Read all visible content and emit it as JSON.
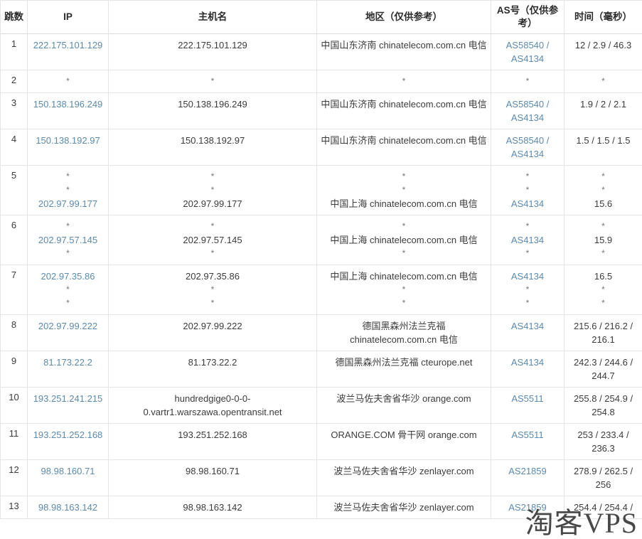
{
  "table": {
    "headers": [
      {
        "label": "跳数",
        "key": "hop"
      },
      {
        "label": "IP",
        "key": "ip"
      },
      {
        "label": "主机名",
        "key": "host"
      },
      {
        "label": "地区（仅供参考）",
        "key": "geo"
      },
      {
        "label": "AS号（仅供参考）",
        "key": "as"
      },
      {
        "label": "时间（毫秒）",
        "key": "time"
      }
    ],
    "star_glyph": "*",
    "link_color": "#5b8ab0",
    "rows": [
      {
        "hop": "1",
        "ip_lines": [
          {
            "text": "222.175.101.129",
            "link": true
          }
        ],
        "host_lines": [
          {
            "text": "222.175.101.129",
            "link": false
          }
        ],
        "geo_lines": [
          {
            "text": "中国山东济南 chinatelecom.com.cn 电信",
            "link": false
          }
        ],
        "as_lines": [
          {
            "text": "AS58540 / AS4134",
            "link": true
          }
        ],
        "time_lines": [
          {
            "text": "12 / 2.9 / 46.3",
            "link": false
          }
        ]
      },
      {
        "hop": "2",
        "ip_lines": [
          {
            "text": "*",
            "link": false
          }
        ],
        "host_lines": [
          {
            "text": "*",
            "link": false
          }
        ],
        "geo_lines": [
          {
            "text": "*",
            "link": false
          }
        ],
        "as_lines": [
          {
            "text": "*",
            "link": false
          }
        ],
        "time_lines": [
          {
            "text": "*",
            "link": false
          }
        ]
      },
      {
        "hop": "3",
        "ip_lines": [
          {
            "text": "150.138.196.249",
            "link": true
          }
        ],
        "host_lines": [
          {
            "text": "150.138.196.249",
            "link": false
          }
        ],
        "geo_lines": [
          {
            "text": "中国山东济南 chinatelecom.com.cn 电信",
            "link": false
          }
        ],
        "as_lines": [
          {
            "text": "AS58540 / AS4134",
            "link": true
          }
        ],
        "time_lines": [
          {
            "text": "1.9 / 2 / 2.1",
            "link": false
          }
        ]
      },
      {
        "hop": "4",
        "ip_lines": [
          {
            "text": "150.138.192.97",
            "link": true
          }
        ],
        "host_lines": [
          {
            "text": "150.138.192.97",
            "link": false
          }
        ],
        "geo_lines": [
          {
            "text": "中国山东济南 chinatelecom.com.cn 电信",
            "link": false
          }
        ],
        "as_lines": [
          {
            "text": "AS58540 / AS4134",
            "link": true
          }
        ],
        "time_lines": [
          {
            "text": "1.5 / 1.5 / 1.5",
            "link": false
          }
        ]
      },
      {
        "hop": "5",
        "ip_lines": [
          {
            "text": "*",
            "link": false
          },
          {
            "text": "*",
            "link": false
          },
          {
            "text": "202.97.99.177",
            "link": true
          }
        ],
        "host_lines": [
          {
            "text": "*",
            "link": false
          },
          {
            "text": "*",
            "link": false
          },
          {
            "text": "202.97.99.177",
            "link": false
          }
        ],
        "geo_lines": [
          {
            "text": "*",
            "link": false
          },
          {
            "text": "*",
            "link": false
          },
          {
            "text": "中国上海 chinatelecom.com.cn 电信",
            "link": false
          }
        ],
        "as_lines": [
          {
            "text": "*",
            "link": false
          },
          {
            "text": "*",
            "link": false
          },
          {
            "text": "AS4134",
            "link": true
          }
        ],
        "time_lines": [
          {
            "text": "*",
            "link": false
          },
          {
            "text": "*",
            "link": false
          },
          {
            "text": "15.6",
            "link": false
          }
        ]
      },
      {
        "hop": "6",
        "ip_lines": [
          {
            "text": "*",
            "link": false
          },
          {
            "text": "202.97.57.145",
            "link": true
          },
          {
            "text": "*",
            "link": false
          }
        ],
        "host_lines": [
          {
            "text": "*",
            "link": false
          },
          {
            "text": "202.97.57.145",
            "link": false
          },
          {
            "text": "*",
            "link": false
          }
        ],
        "geo_lines": [
          {
            "text": "*",
            "link": false
          },
          {
            "text": "中国上海 chinatelecom.com.cn 电信",
            "link": false
          },
          {
            "text": "*",
            "link": false
          }
        ],
        "as_lines": [
          {
            "text": "*",
            "link": false
          },
          {
            "text": "AS4134",
            "link": true
          },
          {
            "text": "*",
            "link": false
          }
        ],
        "time_lines": [
          {
            "text": "*",
            "link": false
          },
          {
            "text": "15.9",
            "link": false
          },
          {
            "text": "*",
            "link": false
          }
        ]
      },
      {
        "hop": "7",
        "ip_lines": [
          {
            "text": "202.97.35.86",
            "link": true
          },
          {
            "text": "*",
            "link": false
          },
          {
            "text": "*",
            "link": false
          }
        ],
        "host_lines": [
          {
            "text": "202.97.35.86",
            "link": false
          },
          {
            "text": "*",
            "link": false
          },
          {
            "text": "*",
            "link": false
          }
        ],
        "geo_lines": [
          {
            "text": "中国上海 chinatelecom.com.cn 电信",
            "link": false
          },
          {
            "text": "*",
            "link": false
          },
          {
            "text": "*",
            "link": false
          }
        ],
        "as_lines": [
          {
            "text": "AS4134",
            "link": true
          },
          {
            "text": "*",
            "link": false
          },
          {
            "text": "*",
            "link": false
          }
        ],
        "time_lines": [
          {
            "text": "16.5",
            "link": false
          },
          {
            "text": "*",
            "link": false
          },
          {
            "text": "*",
            "link": false
          }
        ]
      },
      {
        "hop": "8",
        "ip_lines": [
          {
            "text": "202.97.99.222",
            "link": true
          }
        ],
        "host_lines": [
          {
            "text": "202.97.99.222",
            "link": false
          }
        ],
        "geo_lines": [
          {
            "text": "德国黑森州法兰克福 chinatelecom.com.cn 电信",
            "link": false
          }
        ],
        "as_lines": [
          {
            "text": "AS4134",
            "link": true
          }
        ],
        "time_lines": [
          {
            "text": "215.6 / 216.2 / 216.1",
            "link": false
          }
        ]
      },
      {
        "hop": "9",
        "ip_lines": [
          {
            "text": "81.173.22.2",
            "link": true
          }
        ],
        "host_lines": [
          {
            "text": "81.173.22.2",
            "link": false
          }
        ],
        "geo_lines": [
          {
            "text": "德国黑森州法兰克福 cteurope.net",
            "link": false
          }
        ],
        "as_lines": [
          {
            "text": "AS4134",
            "link": true
          }
        ],
        "time_lines": [
          {
            "text": "242.3 / 244.6 / 244.7",
            "link": false
          }
        ]
      },
      {
        "hop": "10",
        "ip_lines": [
          {
            "text": "193.251.241.215",
            "link": true
          }
        ],
        "host_lines": [
          {
            "text": "hundredgige0-0-0-0.vartr1.warszawa.opentransit.net",
            "link": false
          }
        ],
        "geo_lines": [
          {
            "text": "波兰马佐夫舍省华沙 orange.com",
            "link": false
          }
        ],
        "as_lines": [
          {
            "text": "AS5511",
            "link": true
          }
        ],
        "time_lines": [
          {
            "text": "255.8 / 254.9 / 254.8",
            "link": false
          }
        ]
      },
      {
        "hop": "11",
        "ip_lines": [
          {
            "text": "193.251.252.168",
            "link": true
          }
        ],
        "host_lines": [
          {
            "text": "193.251.252.168",
            "link": false
          }
        ],
        "geo_lines": [
          {
            "text": "ORANGE.COM 骨干网 orange.com",
            "link": false
          }
        ],
        "as_lines": [
          {
            "text": "AS5511",
            "link": true
          }
        ],
        "time_lines": [
          {
            "text": "253 / 233.4 / 236.3",
            "link": false
          }
        ]
      },
      {
        "hop": "12",
        "ip_lines": [
          {
            "text": "98.98.160.71",
            "link": true
          }
        ],
        "host_lines": [
          {
            "text": "98.98.160.71",
            "link": false
          }
        ],
        "geo_lines": [
          {
            "text": "波兰马佐夫舍省华沙 zenlayer.com",
            "link": false
          }
        ],
        "as_lines": [
          {
            "text": "AS21859",
            "link": true
          }
        ],
        "time_lines": [
          {
            "text": "278.9 / 262.5 / 256",
            "link": false
          }
        ]
      },
      {
        "hop": "13",
        "ip_lines": [
          {
            "text": "98.98.163.142",
            "link": true
          }
        ],
        "host_lines": [
          {
            "text": "98.98.163.142",
            "link": false
          }
        ],
        "geo_lines": [
          {
            "text": "波兰马佐夫舍省华沙 zenlayer.com",
            "link": false
          }
        ],
        "as_lines": [
          {
            "text": "AS21859",
            "link": true
          }
        ],
        "time_lines": [
          {
            "text": "254.4 / 254.4 /",
            "link": false
          }
        ]
      }
    ]
  },
  "watermark": {
    "text": "淘客VPS"
  }
}
